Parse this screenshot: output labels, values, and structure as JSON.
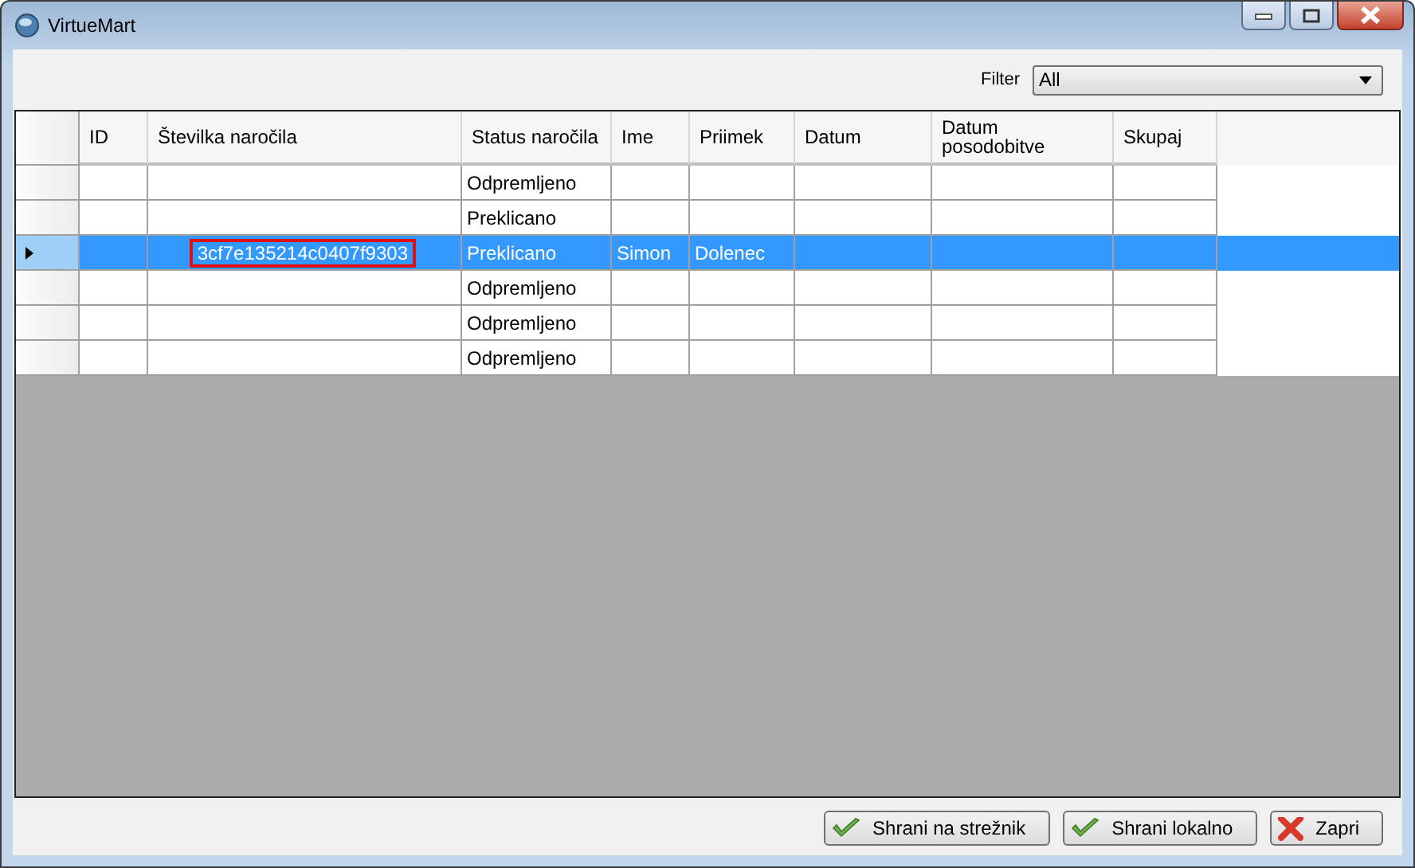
{
  "window": {
    "title": "VirtueMart"
  },
  "filter": {
    "label": "Filter",
    "value": "All"
  },
  "table": {
    "columns": [
      "ID",
      "Številka naročila",
      "Status naročila",
      "Ime",
      "Priimek",
      "Datum",
      "Datum posodobitve",
      "Skupaj"
    ],
    "rows": [
      {
        "selected": false,
        "editing": false,
        "cells": [
          "",
          "",
          "Odpremljeno",
          "",
          "",
          "",
          "",
          ""
        ]
      },
      {
        "selected": false,
        "editing": false,
        "cells": [
          "",
          "",
          "Preklicano",
          "",
          "",
          "",
          "",
          ""
        ]
      },
      {
        "selected": true,
        "editing": true,
        "cells": [
          "",
          "3cf7e135214c0407f9303",
          "Preklicano",
          "Simon",
          "Dolenec",
          "",
          "",
          ""
        ]
      },
      {
        "selected": false,
        "editing": false,
        "cells": [
          "",
          "",
          "Odpremljeno",
          "",
          "",
          "",
          "",
          ""
        ]
      },
      {
        "selected": false,
        "editing": false,
        "cells": [
          "",
          "",
          "Odpremljeno",
          "",
          "",
          "",
          "",
          ""
        ]
      },
      {
        "selected": false,
        "editing": false,
        "cells": [
          "",
          "",
          "Odpremljeno",
          "",
          "",
          "",
          "",
          ""
        ]
      }
    ]
  },
  "buttons": [
    {
      "kind": "confirm",
      "label": "Shrani na strežnik"
    },
    {
      "kind": "confirm",
      "label": "Shrani lokalno"
    },
    {
      "kind": "close",
      "label": "Zapri"
    }
  ]
}
